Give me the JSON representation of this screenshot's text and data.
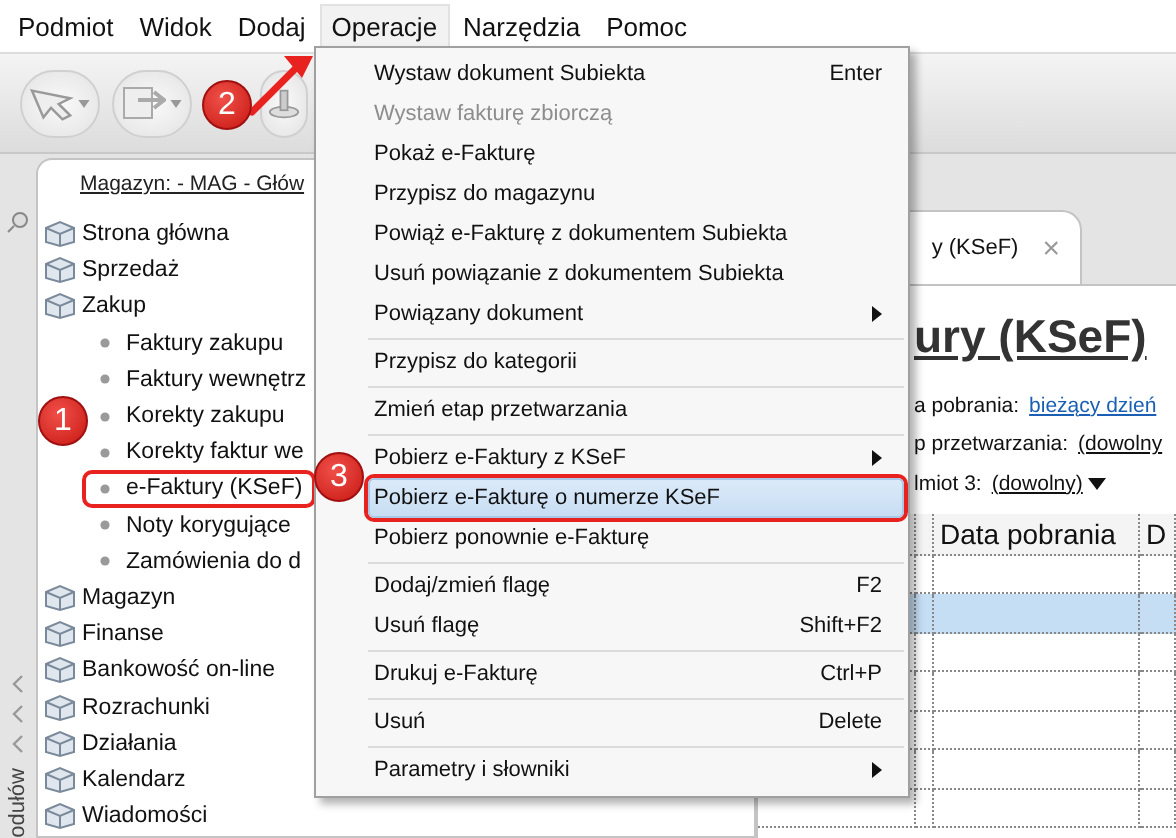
{
  "menu_bar": [
    {
      "label": "Podmiot",
      "selected": false
    },
    {
      "label": "Widok",
      "selected": false
    },
    {
      "label": "Dodaj",
      "selected": false
    },
    {
      "label": "Operacje",
      "selected": true
    },
    {
      "label": "Narzędzia",
      "selected": false
    },
    {
      "label": "Pomoc",
      "selected": false
    }
  ],
  "sidebar": {
    "header": "Magazyn: - MAG - Głów",
    "collapse_label": "odułów",
    "items": [
      {
        "label": "Strona główna"
      },
      {
        "label": "Sprzedaż"
      },
      {
        "label": "Zakup",
        "children": [
          {
            "label": "Faktury zakupu",
            "outlined": false
          },
          {
            "label": "Faktury wewnętrz",
            "outlined": false
          },
          {
            "label": "Korekty zakupu",
            "outlined": false
          },
          {
            "label": "Korekty faktur we",
            "outlined": false
          },
          {
            "label": "e-Faktury (KSeF)",
            "outlined": true
          },
          {
            "label": "Noty korygujące",
            "outlined": false
          },
          {
            "label": "Zamówienia do d",
            "outlined": false
          }
        ]
      },
      {
        "label": "Magazyn"
      },
      {
        "label": "Finanse"
      },
      {
        "label": "Bankowość on-line"
      },
      {
        "label": "Rozrachunki"
      },
      {
        "label": "Działania"
      },
      {
        "label": "Kalendarz"
      },
      {
        "label": "Wiadomości"
      }
    ]
  },
  "context_menu": {
    "items": [
      {
        "kind": "item",
        "label": "Wystaw dokument Subiekta",
        "shortcut": "Enter",
        "disabled": false,
        "submenu": false,
        "selected": false
      },
      {
        "kind": "item",
        "label": "Wystaw fakturę zbiorczą",
        "disabled": true,
        "submenu": false,
        "selected": false
      },
      {
        "kind": "item",
        "label": "Pokaż e-Fakturę",
        "disabled": false,
        "submenu": false,
        "selected": false
      },
      {
        "kind": "item",
        "label": "Przypisz do magazynu",
        "disabled": false,
        "submenu": false,
        "selected": false
      },
      {
        "kind": "item",
        "label": "Powiąż e-Fakturę z dokumentem Subiekta",
        "disabled": false,
        "submenu": false,
        "selected": false
      },
      {
        "kind": "item",
        "label": "Usuń powiązanie z dokumentem Subiekta",
        "disabled": false,
        "submenu": false,
        "selected": false
      },
      {
        "kind": "item",
        "label": "Powiązany dokument",
        "disabled": false,
        "submenu": true,
        "selected": false
      },
      {
        "kind": "separator"
      },
      {
        "kind": "item",
        "label": "Przypisz do kategorii",
        "disabled": false,
        "submenu": false,
        "selected": false
      },
      {
        "kind": "separator"
      },
      {
        "kind": "item",
        "label": "Zmień etap przetwarzania",
        "disabled": false,
        "submenu": false,
        "selected": false
      },
      {
        "kind": "separator"
      },
      {
        "kind": "item",
        "label": "Pobierz e-Faktury z KSeF",
        "disabled": false,
        "submenu": true,
        "selected": false
      },
      {
        "kind": "item",
        "label": "Pobierz e-Fakturę o numerze KSeF",
        "disabled": false,
        "submenu": false,
        "selected": true
      },
      {
        "kind": "item",
        "label": "Pobierz ponownie e-Fakturę",
        "disabled": false,
        "submenu": false,
        "selected": false
      },
      {
        "kind": "separator"
      },
      {
        "kind": "item",
        "label": "Dodaj/zmień flagę",
        "shortcut": "F2",
        "disabled": false,
        "submenu": false,
        "selected": false
      },
      {
        "kind": "item",
        "label": "Usuń flagę",
        "shortcut": "Shift+F2",
        "disabled": false,
        "submenu": false,
        "selected": false
      },
      {
        "kind": "separator"
      },
      {
        "kind": "item",
        "label": "Drukuj e-Fakturę",
        "shortcut": "Ctrl+P",
        "disabled": false,
        "submenu": false,
        "selected": false
      },
      {
        "kind": "separator"
      },
      {
        "kind": "item",
        "label": "Usuń",
        "shortcut": "Delete",
        "disabled": false,
        "submenu": false,
        "selected": false
      },
      {
        "kind": "separator"
      },
      {
        "kind": "item",
        "label": "Parametry i słowniki",
        "disabled": false,
        "submenu": true,
        "selected": false
      }
    ]
  },
  "document": {
    "tab": {
      "label": "y (KSeF)",
      "close": "×",
      "selected": true
    },
    "title": "ury (KSeF)",
    "filters": [
      {
        "label": "a pobrania:",
        "value": "bieżący dzień",
        "dropdown": false
      },
      {
        "label": "p przetwarzania:",
        "value": "(dowolny",
        "dropdown": false
      },
      {
        "label": "lmiot 3:",
        "value": "(dowolny)",
        "dropdown": true
      }
    ],
    "table": {
      "columns": [
        "Data pobrania",
        "D"
      ],
      "rows": [
        {
          "selected": false
        },
        {
          "selected": true
        },
        {
          "selected": false
        },
        {
          "selected": false
        },
        {
          "selected": false
        },
        {
          "selected": false
        },
        {
          "selected": false
        }
      ]
    }
  },
  "annotations": [
    {
      "number": "1"
    },
    {
      "number": "2"
    },
    {
      "number": "3"
    }
  ]
}
